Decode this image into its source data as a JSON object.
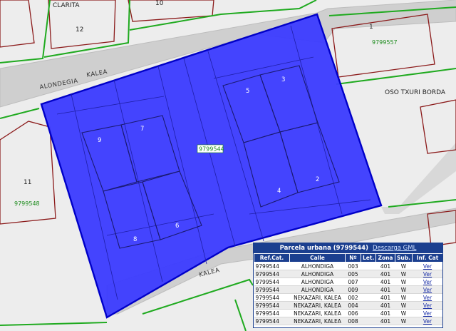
{
  "map": {
    "street_labels": [
      {
        "id": "clarita",
        "text": "CLARITA"
      },
      {
        "id": "alondegia",
        "text": "ALONDEGIA"
      },
      {
        "id": "kalea_top",
        "text": "KALEA"
      },
      {
        "id": "kalea_bottom",
        "text": "KALEA"
      },
      {
        "id": "oso_txuri",
        "text": "OSO TXURI BORDA"
      }
    ],
    "lot_numbers": [
      {
        "id": "n10",
        "text": "10"
      },
      {
        "id": "n12",
        "text": "12"
      },
      {
        "id": "n1",
        "text": "1"
      },
      {
        "id": "n11",
        "text": "11"
      }
    ],
    "parcel_refs": [
      {
        "id": "r9799557",
        "text": "9799557"
      },
      {
        "id": "r9799548",
        "text": "9799548"
      }
    ],
    "selected_parcel": {
      "ref": "9799544",
      "fill_color": "#3b3bff",
      "outline_color": "#0000c8"
    },
    "building_numbers": [
      {
        "id": "b9",
        "text": "9"
      },
      {
        "id": "b7",
        "text": "7"
      },
      {
        "id": "b5",
        "text": "5"
      },
      {
        "id": "b3",
        "text": "3"
      },
      {
        "id": "b2",
        "text": "2"
      },
      {
        "id": "b4",
        "text": "4"
      },
      {
        "id": "b8",
        "text": "8"
      },
      {
        "id": "b6",
        "text": "6"
      }
    ],
    "colors": {
      "street_fill": "#cfcfcf",
      "block_fill": "#ededed",
      "lot_outline": "#8b1a1a",
      "block_outline": "#1faa1f"
    }
  },
  "info_panel": {
    "title": "Parcela urbana (9799544)",
    "gml_link": "Descarga GML",
    "columns": [
      "Ref.Cat.",
      "Calle",
      "Nº",
      "Let.",
      "Zona",
      "Sub.",
      "Inf. Cat"
    ],
    "rows": [
      [
        "9799544",
        "ALHONDIGA",
        "003",
        "",
        "401",
        "W",
        "Ver"
      ],
      [
        "9799544",
        "ALHONDIGA",
        "005",
        "",
        "401",
        "W",
        "Ver"
      ],
      [
        "9799544",
        "ALHONDIGA",
        "007",
        "",
        "401",
        "W",
        "Ver"
      ],
      [
        "9799544",
        "ALHONDIGA",
        "009",
        "",
        "401",
        "W",
        "Ver"
      ],
      [
        "9799544",
        "NEKAZARI, KALEA",
        "002",
        "",
        "401",
        "W",
        "Ver"
      ],
      [
        "9799544",
        "NEKAZARI, KALEA",
        "004",
        "",
        "401",
        "W",
        "Ver"
      ],
      [
        "9799544",
        "NEKAZARI, KALEA",
        "006",
        "",
        "401",
        "W",
        "Ver"
      ],
      [
        "9799544",
        "NEKAZARI, KALEA",
        "008",
        "",
        "401",
        "W",
        "Ver"
      ]
    ]
  }
}
